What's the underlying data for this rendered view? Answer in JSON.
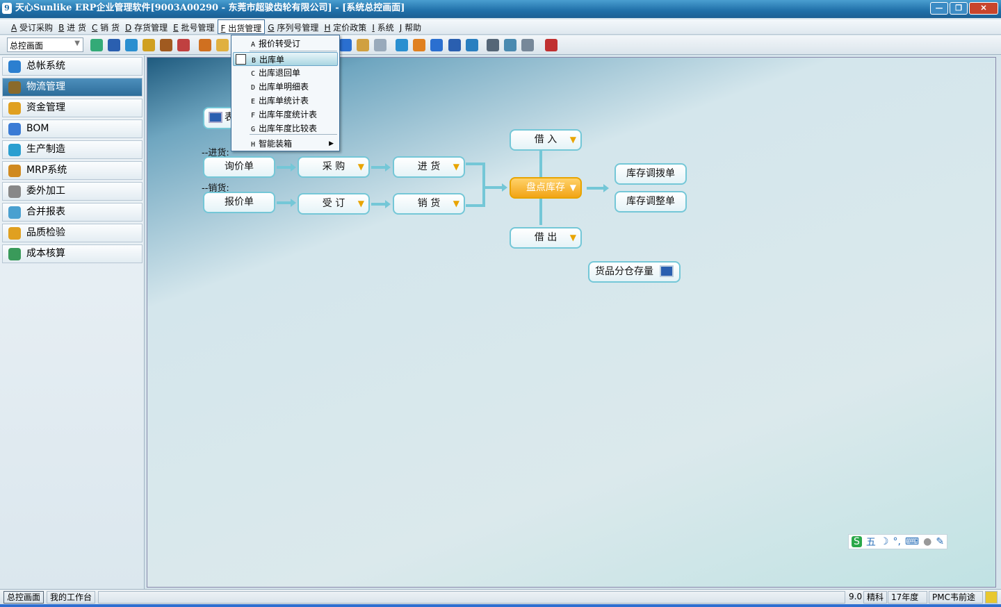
{
  "window": {
    "title": "天心Sunlike ERP企业管理软件[9003A00290 - 东莞市超骏齿轮有限公司] - [系统总控画面]",
    "minimize": "—",
    "restore": "❐",
    "close": "✕"
  },
  "menu": [
    {
      "key": "A",
      "label": "受订采购"
    },
    {
      "key": "B",
      "label": "进 货"
    },
    {
      "key": "C",
      "label": "销 货"
    },
    {
      "key": "D",
      "label": "存货管理"
    },
    {
      "key": "E",
      "label": "批号管理"
    },
    {
      "key": "F",
      "label": "出货管理"
    },
    {
      "key": "G",
      "label": "序列号管理"
    },
    {
      "key": "H",
      "label": "定价政策"
    },
    {
      "key": "I",
      "label": "系统"
    },
    {
      "key": "J",
      "label": "帮助"
    }
  ],
  "toolbar": {
    "combo_value": "总控画面"
  },
  "dropdown": [
    {
      "key": "A",
      "label": "报价转受订"
    },
    {
      "key": "B",
      "label": "出库单"
    },
    {
      "key": "C",
      "label": "出库退回单"
    },
    {
      "key": "D",
      "label": "出库单明细表"
    },
    {
      "key": "E",
      "label": "出库单统计表"
    },
    {
      "key": "F",
      "label": "出库年度统计表"
    },
    {
      "key": "G",
      "label": "出库年度比较表"
    },
    {
      "key": "H",
      "label": "智能装箱"
    }
  ],
  "sidebar": [
    {
      "label": "总帐系统",
      "color": "#2b7fd0"
    },
    {
      "label": "物流管理",
      "color": "#8a6a2a"
    },
    {
      "label": "资金管理",
      "color": "#e0a020"
    },
    {
      "label": "BOM",
      "color": "#3a7bd5"
    },
    {
      "label": "生产制造",
      "color": "#2a9fd0"
    },
    {
      "label": "MRP系统",
      "color": "#d08a20"
    },
    {
      "label": "委外加工",
      "color": "#888888"
    },
    {
      "label": "合并报表",
      "color": "#4aa0d0"
    },
    {
      "label": "品质检验",
      "color": "#e0a020"
    },
    {
      "label": "成本核算",
      "color": "#3a9a5a"
    }
  ],
  "flow": {
    "purchase_label": "--进货:",
    "sales_label": "--销货:",
    "inquiry": "询价单",
    "purchase": "采  购",
    "receive": "进  货",
    "quote": "报价单",
    "order": "受  订",
    "sell": "销  货",
    "borrow_in": "借  入",
    "stocktake": "盘点库存",
    "borrow_out": "借  出",
    "transfer": "库存调拨单",
    "adjust": "库存调整单",
    "warehouse_stock": "货品分仓存量",
    "partial_button": "表"
  },
  "statusbar": {
    "tab1": "总控画面",
    "tab2": "我的工作台",
    "version": "9.0",
    "edition": "精科",
    "year": "17年度",
    "user": "PMC韦前途"
  },
  "ime": {
    "label": "五"
  }
}
